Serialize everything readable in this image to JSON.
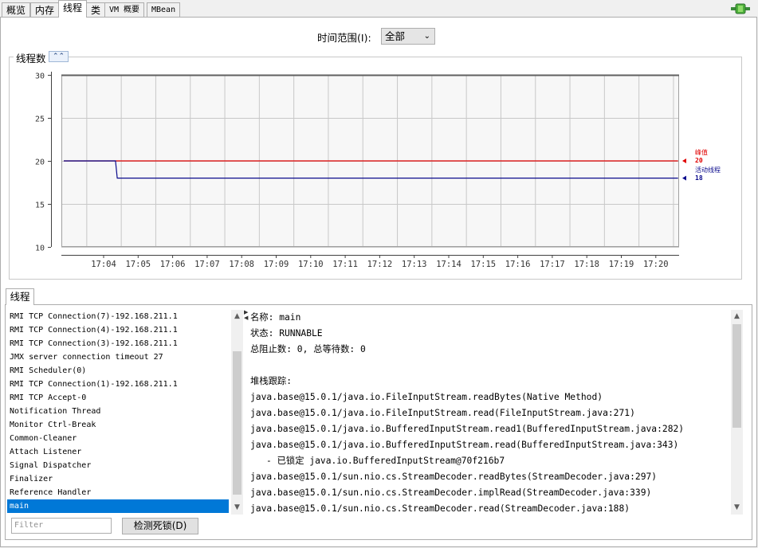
{
  "tabs": [
    {
      "label": "概览",
      "active": false
    },
    {
      "label": "内存",
      "active": false
    },
    {
      "label": "线程",
      "active": true
    },
    {
      "label": "类",
      "active": false
    },
    {
      "label": "VM 概要",
      "active": false
    },
    {
      "label": "MBean",
      "active": false
    }
  ],
  "time_range": {
    "label": "时间范围(I):",
    "value": "全部"
  },
  "chart_panel_title": "线程数",
  "chart_data": {
    "type": "line",
    "ylim": [
      10,
      30
    ],
    "yticks": [
      10,
      15,
      20,
      25,
      30
    ],
    "xticks": [
      "17:04",
      "17:05",
      "17:06",
      "17:07",
      "17:08",
      "17:09",
      "17:10",
      "17:11",
      "17:12",
      "17:13",
      "17:14",
      "17:15",
      "17:16",
      "17:17",
      "17:18",
      "17:19",
      "17:20"
    ],
    "grid": true,
    "series": [
      {
        "name": "峰值",
        "color": "#e00000",
        "current": "20",
        "points": [
          [
            0,
            20
          ],
          [
            17.8,
            20
          ]
        ]
      },
      {
        "name": "活动线程",
        "color": "#0a0a8c",
        "current": "18",
        "points": [
          [
            0,
            20
          ],
          [
            1.5,
            20
          ],
          [
            1.55,
            18
          ],
          [
            17.8,
            18
          ]
        ]
      }
    ]
  },
  "threads_tab": "线程",
  "threads": [
    "RMI TCP Connection(7)-192.168.211.1",
    "RMI TCP Connection(4)-192.168.211.1",
    "RMI TCP Connection(3)-192.168.211.1",
    "JMX server connection timeout 27",
    "RMI Scheduler(0)",
    "RMI TCP Connection(1)-192.168.211.1",
    "RMI TCP Accept-0",
    "Notification Thread",
    "Monitor Ctrl-Break",
    "Common-Cleaner",
    "Attach Listener",
    "Signal Dispatcher",
    "Finalizer",
    "Reference Handler",
    "main"
  ],
  "selected_thread": "main",
  "filter_placeholder": "Filter",
  "detect_deadlock_label": "检测死锁(D)",
  "thread_detail": [
    "名称: main",
    "状态: RUNNABLE",
    "总阻止数: 0, 总等待数: 0",
    "",
    "堆栈跟踪:",
    "java.base@15.0.1/java.io.FileInputStream.readBytes(Native Method)",
    "java.base@15.0.1/java.io.FileInputStream.read(FileInputStream.java:271)",
    "java.base@15.0.1/java.io.BufferedInputStream.read1(BufferedInputStream.java:282)",
    "java.base@15.0.1/java.io.BufferedInputStream.read(BufferedInputStream.java:343)",
    "  - 已锁定 java.io.BufferedInputStream@70f216b7",
    "java.base@15.0.1/sun.nio.cs.StreamDecoder.readBytes(StreamDecoder.java:297)",
    "java.base@15.0.1/sun.nio.cs.StreamDecoder.implRead(StreamDecoder.java:339)",
    "java.base@15.0.1/sun.nio.cs.StreamDecoder.read(StreamDecoder.java:188)"
  ]
}
